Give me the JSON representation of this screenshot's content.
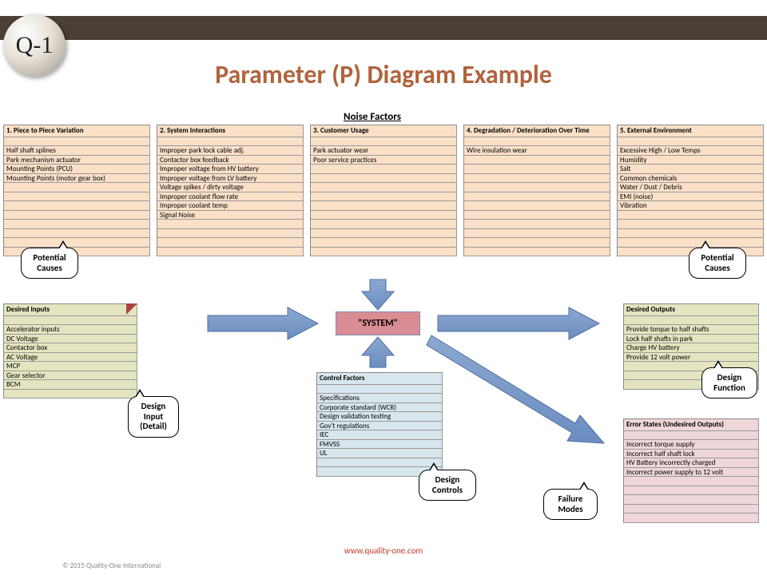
{
  "logo_text": "Q-1",
  "title": "Parameter (P) Diagram Example",
  "noise_label": "Noise Factors",
  "system_label": "\"SYSTEM\"",
  "footer_url": "www.quality-one.com",
  "copyright": "© 2015 Quality-One International",
  "callouts": {
    "potential_causes": "Potential\nCauses",
    "design_input": "Design\nInput\n(Detail)",
    "design_controls": "Design\nControls",
    "design_function": "Design\nFunction",
    "failure_modes": "Failure\nModes"
  },
  "noise": [
    {
      "title": "1. Piece to Piece Variation",
      "items": [
        "Half shaft splines",
        "Park mechanism actuator",
        "Mounting Points (PCU)",
        "Mounting Points (motor gear box)"
      ]
    },
    {
      "title": "2. System Interactions",
      "items": [
        "Improper park lock cable adj.",
        "Contactor box feedback",
        "Improper voltage from HV battery",
        "Improper voltage from LV battery",
        "Voltage spikes / dirty voltage",
        "Improper coolant flow rate",
        "Improper coolant temp",
        "Signal Noise"
      ]
    },
    {
      "title": "3. Customer Usage",
      "items": [
        "Park actuator wear",
        "Poor service practices"
      ]
    },
    {
      "title": "4. Degradation / Deterioration Over Time",
      "items": [
        "Wire insulation wear"
      ]
    },
    {
      "title": "5. External Environment",
      "items": [
        "Excessive High / Low Temps",
        "Humidity",
        "Salt",
        "Common chemicals",
        "Water / Dust / Debris",
        "EMI (noise)",
        "Vibration"
      ]
    }
  ],
  "inputs": {
    "title": "Desired Inputs",
    "items": [
      "Accelerator inputs",
      "DC Voltage",
      "Contactor box",
      "AC Voltage",
      "MCP",
      "Gear selector",
      "BCM"
    ]
  },
  "control": {
    "title": "Control Factors",
    "items": [
      "Specifications",
      "Corporate standard (WCR)",
      "Design validation testing",
      "Gov't regulations",
      "IEC",
      "FMVSS",
      "UL"
    ]
  },
  "outputs": {
    "title": "Desired Outputs",
    "items": [
      "Provide torque to half shafts",
      "Lock half shafts in park",
      "Charge HV battery",
      "Provide 12 volt power"
    ]
  },
  "errors": {
    "title": "Error States (Undesired Outputs)",
    "items": [
      "Incorrect torque supply",
      "Incorrect half shaft lock",
      "HV Battery incorrectly charged",
      "Incorrect power supply to 12 volt"
    ]
  }
}
